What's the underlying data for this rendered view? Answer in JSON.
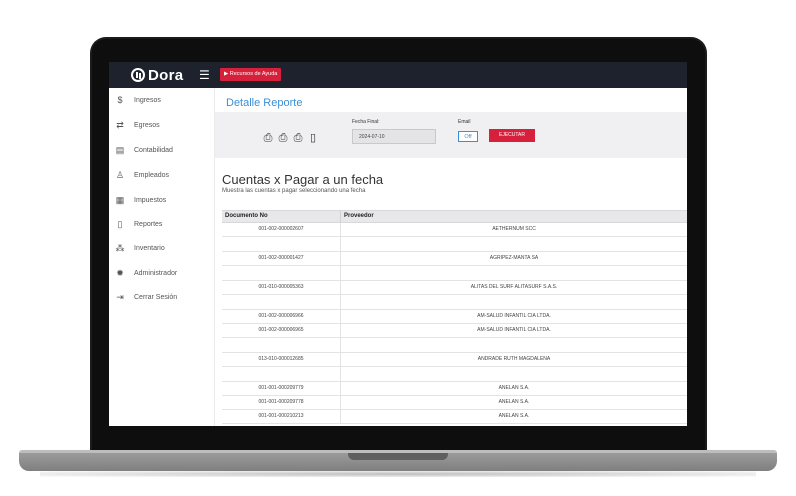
{
  "app": {
    "name": "Dora",
    "help_button": "▶ Recursos de Ayuda"
  },
  "sidebar": {
    "items": [
      {
        "label": "Ingresos",
        "icon": "money-in-icon"
      },
      {
        "label": "Egresos",
        "icon": "money-out-icon"
      },
      {
        "label": "Contabilidad",
        "icon": "calculator-icon"
      },
      {
        "label": "Empleados",
        "icon": "users-icon"
      },
      {
        "label": "Impuestos",
        "icon": "tax-icon"
      },
      {
        "label": "Reportes",
        "icon": "report-icon"
      },
      {
        "label": "Inventario",
        "icon": "boxes-icon"
      },
      {
        "label": "Administrador",
        "icon": "gear-icon"
      },
      {
        "label": "Cerrar Sesión",
        "icon": "logout-icon"
      }
    ]
  },
  "page": {
    "breadcrumb": "Detalle Reporte"
  },
  "filter": {
    "fecha_final_label": "Fecha Final:",
    "fecha_final_value": "2024-07-10",
    "email_label": "Email",
    "email_toggle": "Off",
    "execute_label": "EJECUTAR"
  },
  "report": {
    "title": "Cuentas x Pagar a un fecha",
    "subtitle": "Muestra las cuentas x pagar seleccionando una fecha",
    "columns": [
      "Documento No",
      "Proveedor"
    ],
    "rows": [
      {
        "doc": "001-002-000002607",
        "prov": "AETHERNUM SCC"
      },
      {
        "doc": "",
        "prov": ""
      },
      {
        "doc": "001-002-000001427",
        "prov": "AGRIPEZ-MANTA SA"
      },
      {
        "doc": "",
        "prov": ""
      },
      {
        "doc": "001-010-000005363",
        "prov": "ALITAS DEL SURF ALITASURF S.A.S."
      },
      {
        "doc": "",
        "prov": ""
      },
      {
        "doc": "001-002-000006966",
        "prov": "AM-SALUD INFANTIL CIA LTDA."
      },
      {
        "doc": "001-002-000006965",
        "prov": "AM-SALUD INFANTIL CIA LTDA."
      },
      {
        "doc": "",
        "prov": ""
      },
      {
        "doc": "013-010-000012685",
        "prov": "ANDRADE RUTH MAGDALENA"
      },
      {
        "doc": "",
        "prov": ""
      },
      {
        "doc": "001-001-000209779",
        "prov": "ANELAN S.A."
      },
      {
        "doc": "001-001-000209778",
        "prov": "ANELAN S.A."
      },
      {
        "doc": "001-001-000210213",
        "prov": "ANELAN S.A."
      }
    ]
  }
}
